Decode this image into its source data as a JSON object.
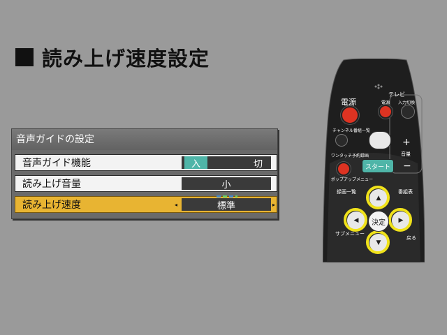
{
  "page": {
    "title": "読み上げ速度設定"
  },
  "panel": {
    "header": "音声ガイドの設定",
    "rows": [
      {
        "label": "音声ガイド機能",
        "toggle_on": "入",
        "toggle_off": "切"
      },
      {
        "label": "読み上げ音量",
        "value": "小"
      },
      {
        "label": "読み上げ速度",
        "value": "標準",
        "left_arrow": "◂",
        "right_arrow": "▸"
      }
    ]
  },
  "remote": {
    "power_label": "電源",
    "tv_label": "テレビ",
    "tv_power_label": "電源",
    "tv_input_label": "入力切換",
    "channel_list_label": "チャンネル番組一覧",
    "one_touch_label": "ワンタッチ予約録画",
    "start_label": "スタート",
    "volume_label": "音量",
    "plus": "+",
    "minus": "−",
    "popup_label": "ポップアップメニュー",
    "rec_list_label": "録画一覧",
    "guide_label": "番組表",
    "submenu_label": "サブメニュー",
    "back_label": "戻る",
    "enter_label": "決定",
    "up": "▲",
    "down": "▼",
    "left": "◀",
    "right": "▶",
    "accent_color": "#f0e21a"
  }
}
